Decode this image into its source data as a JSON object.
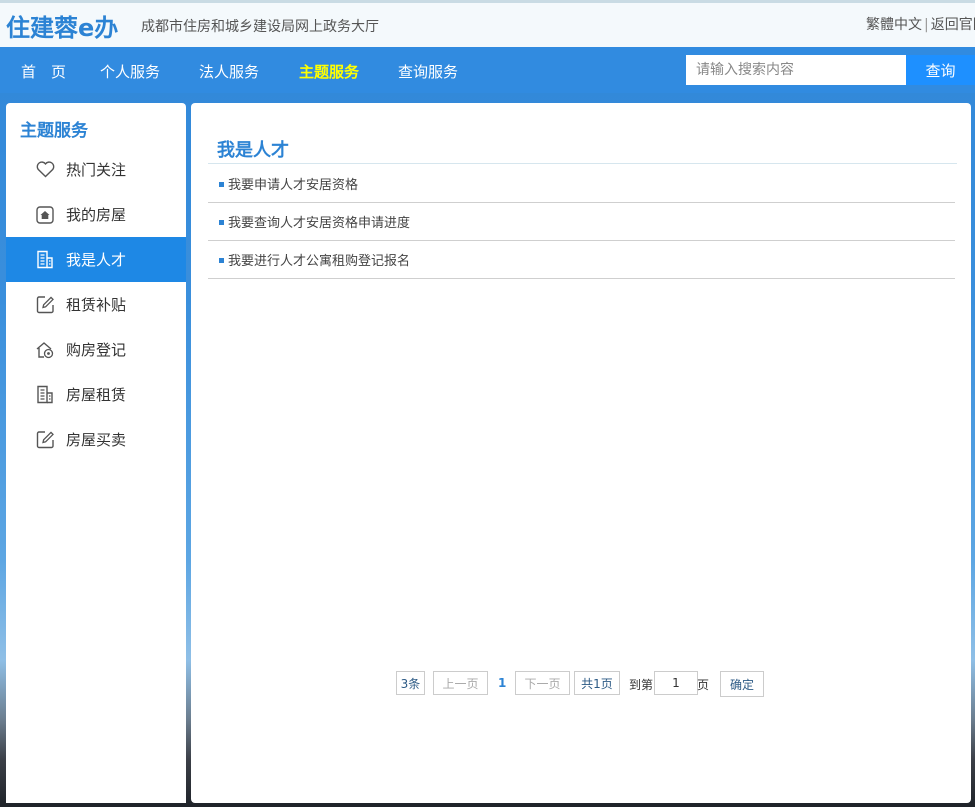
{
  "header": {
    "logo": "住建蓉e办",
    "subtitle": "成都市住房和城乡建设局网上政务大厅",
    "lang_link": "繁體中文",
    "separator": "|",
    "home_link": "返回官网"
  },
  "nav": {
    "items": [
      {
        "label": "首　页"
      },
      {
        "label": "个人服务"
      },
      {
        "label": "法人服务"
      },
      {
        "label": "主题服务",
        "active": true
      },
      {
        "label": "查询服务"
      }
    ],
    "search_placeholder": "请输入搜索内容",
    "search_value": "",
    "search_button": "查询"
  },
  "sidebar": {
    "title": "主题服务",
    "items": [
      {
        "label": "热门关注",
        "icon": "heart-icon"
      },
      {
        "label": "我的房屋",
        "icon": "house-icon"
      },
      {
        "label": "我是人才",
        "icon": "building-doc-icon",
        "active": true
      },
      {
        "label": "租赁补贴",
        "icon": "edit-icon"
      },
      {
        "label": "购房登记",
        "icon": "house-register-icon"
      },
      {
        "label": "房屋租赁",
        "icon": "building-doc-icon"
      },
      {
        "label": "房屋买卖",
        "icon": "edit-icon"
      }
    ]
  },
  "main": {
    "title": "我是人才",
    "items": [
      {
        "label": "我要申请人才安居资格"
      },
      {
        "label": "我要查询人才安居资格申请进度"
      },
      {
        "label": "我要进行人才公寓租购登记报名"
      }
    ]
  },
  "pager": {
    "count": "3条",
    "prev": "上一页",
    "current": "1",
    "next": "下一页",
    "total": "共1页",
    "goto_prefix": "到第",
    "goto_value": "1",
    "goto_suffix": "页",
    "confirm": "确定"
  },
  "colors": {
    "accent": "#2c83d4",
    "nav_bg": "#318be0",
    "active_nav": "#ffff00",
    "sidebar_active": "#1e88e5"
  }
}
